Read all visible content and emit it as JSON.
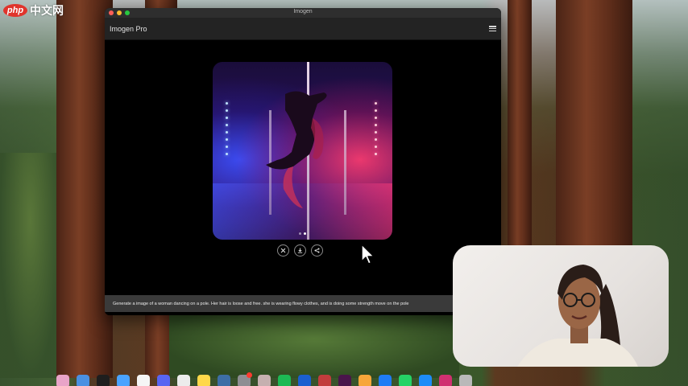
{
  "watermark": {
    "mark": "php",
    "text": "中文网"
  },
  "window": {
    "title": "Imogen",
    "app_name": "Imogen Pro",
    "menu_icon": "hamburger-menu-icon"
  },
  "image_viewer": {
    "carousel_active_index": 2,
    "carousel_count": 2,
    "actions": [
      {
        "name": "close-button",
        "icon": "close-icon"
      },
      {
        "name": "download-button",
        "icon": "download-icon"
      },
      {
        "name": "share-button",
        "icon": "share-icon"
      }
    ]
  },
  "prompt": {
    "text": "Generate a image of a woman dancing on a pole. Her hair is loose and free. she is wearing flowy clothes, and is doing some strength move on the pole"
  },
  "colors": {
    "window_bg": "#000000",
    "titlebar_bg": "#2e2e2e",
    "toolbar_bg": "#232323",
    "prompt_bar_bg": "#3a3a3a"
  },
  "dock": {
    "icons": [
      {
        "name": "dock-icon-photos",
        "color": "#e9a4c8"
      },
      {
        "name": "dock-icon-chrome",
        "color": "#4a90e2"
      },
      {
        "name": "dock-icon-terminal",
        "color": "#1e1e1e"
      },
      {
        "name": "dock-icon-finder",
        "color": "#4aa3ff"
      },
      {
        "name": "dock-icon-notion",
        "color": "#f5f5f5"
      },
      {
        "name": "dock-icon-discord",
        "color": "#5865f2"
      },
      {
        "name": "dock-icon-notes-app",
        "color": "#ececec"
      },
      {
        "name": "dock-icon-notes",
        "color": "#ffd84a"
      },
      {
        "name": "dock-icon-preview",
        "color": "#3d6ea6"
      },
      {
        "name": "dock-icon-settings",
        "color": "#8e8e93",
        "badge": true
      },
      {
        "name": "dock-icon-maps",
        "color": "#c6b0b0"
      },
      {
        "name": "dock-icon-spotify",
        "color": "#1db954"
      },
      {
        "name": "dock-icon-1password",
        "color": "#1a5fd0"
      },
      {
        "name": "dock-icon-reeder",
        "color": "#c23c3c"
      },
      {
        "name": "dock-icon-slack",
        "color": "#4a154b"
      },
      {
        "name": "dock-icon-pencil",
        "color": "#f7a63a"
      },
      {
        "name": "dock-icon-mail",
        "color": "#1f7cf5"
      },
      {
        "name": "dock-icon-whatsapp",
        "color": "#25d366"
      },
      {
        "name": "dock-icon-appstore",
        "color": "#1d8cf8"
      },
      {
        "name": "dock-icon-mirror",
        "color": "#d03070"
      },
      {
        "name": "dock-icon-trash",
        "color": "#b9b9b9"
      }
    ]
  }
}
